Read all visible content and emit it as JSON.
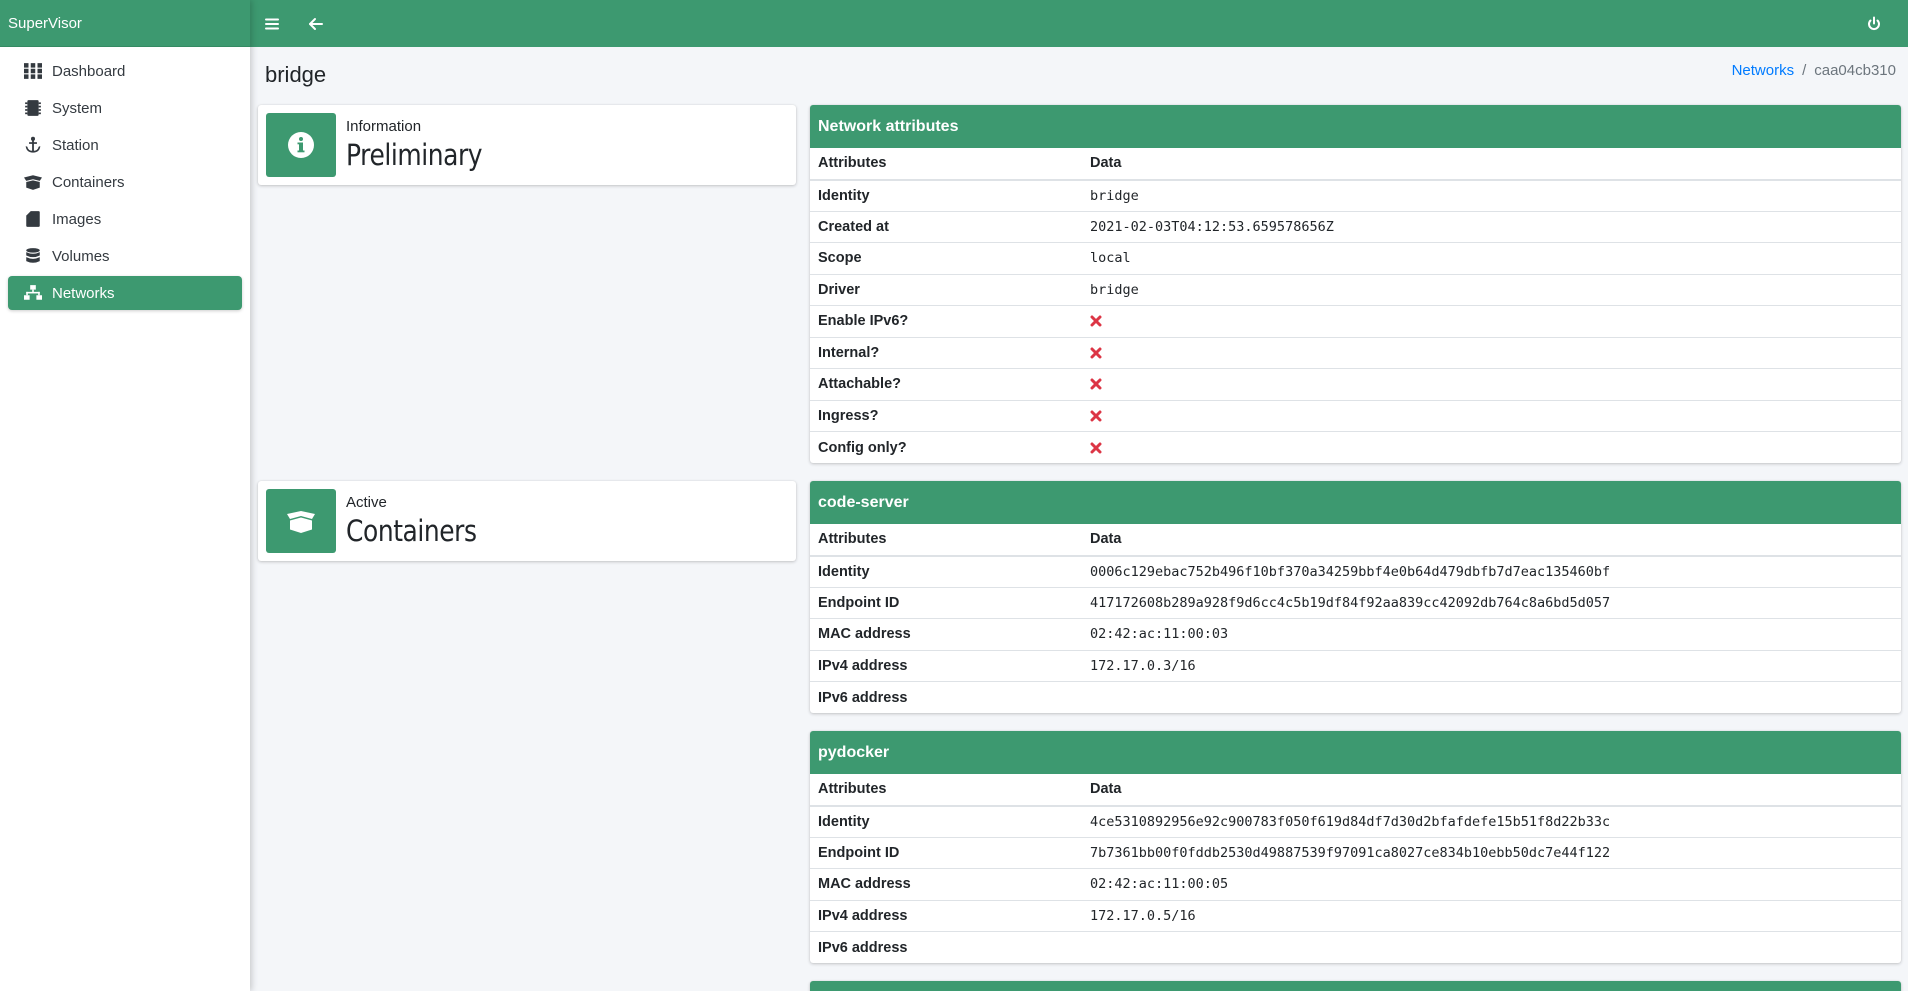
{
  "brand": "SuperVisor",
  "sidebar": {
    "items": [
      {
        "label": "Dashboard",
        "icon": "grid-icon"
      },
      {
        "label": "System",
        "icon": "memory-icon"
      },
      {
        "label": "Station",
        "icon": "anchor-icon"
      },
      {
        "label": "Containers",
        "icon": "box-open-icon"
      },
      {
        "label": "Images",
        "icon": "sd-card-icon"
      },
      {
        "label": "Volumes",
        "icon": "database-icon"
      },
      {
        "label": "Networks",
        "icon": "network-icon",
        "active": true
      }
    ]
  },
  "page": {
    "title": "bridge",
    "breadcrumb": {
      "link": "Networks",
      "separator": "/",
      "current": "caa04cb310"
    }
  },
  "info_boxes": [
    {
      "label": "Information",
      "value": "Preliminary",
      "icon": "info-circle-icon"
    },
    {
      "label": "Active",
      "value": "Containers",
      "icon": "box-open-icon"
    }
  ],
  "network_attributes": {
    "title": "Network attributes",
    "columns": [
      "Attributes",
      "Data"
    ],
    "rows": [
      {
        "attr": "Identity",
        "value": "bridge"
      },
      {
        "attr": "Created at",
        "value": "2021-02-03T04:12:53.659578656Z"
      },
      {
        "attr": "Scope",
        "value": "local"
      },
      {
        "attr": "Driver",
        "value": "bridge"
      },
      {
        "attr": "Enable IPv6?",
        "value": false
      },
      {
        "attr": "Internal?",
        "value": false
      },
      {
        "attr": "Attachable?",
        "value": false
      },
      {
        "attr": "Ingress?",
        "value": false
      },
      {
        "attr": "Config only?",
        "value": false
      }
    ]
  },
  "containers": [
    {
      "title": "code-server",
      "columns": [
        "Attributes",
        "Data"
      ],
      "rows": [
        {
          "attr": "Identity",
          "value": "0006c129ebac752b496f10bf370a34259bbf4e0b64d479dbfb7d7eac135460bf"
        },
        {
          "attr": "Endpoint ID",
          "value": "417172608b289a928f9d6cc4c5b19df84f92aa839cc42092db764c8a6bd5d057"
        },
        {
          "attr": "MAC address",
          "value": "02:42:ac:11:00:03"
        },
        {
          "attr": "IPv4 address",
          "value": "172.17.0.3/16"
        },
        {
          "attr": "IPv6 address",
          "value": ""
        }
      ]
    },
    {
      "title": "pydocker",
      "columns": [
        "Attributes",
        "Data"
      ],
      "rows": [
        {
          "attr": "Identity",
          "value": "4ce5310892956e92c900783f050f619d84df7d30d2bfafdefe15b51f8d22b33c"
        },
        {
          "attr": "Endpoint ID",
          "value": "7b7361bb00f0fddb2530d49887539f97091ca8027ce834b10ebb50dc7e44f122"
        },
        {
          "attr": "MAC address",
          "value": "02:42:ac:11:00:05"
        },
        {
          "attr": "IPv4 address",
          "value": "172.17.0.5/16"
        },
        {
          "attr": "IPv6 address",
          "value": ""
        }
      ]
    }
  ],
  "colors": {
    "accent": "#3d9970",
    "link": "#007bff",
    "false_mark": "#dc3545"
  }
}
